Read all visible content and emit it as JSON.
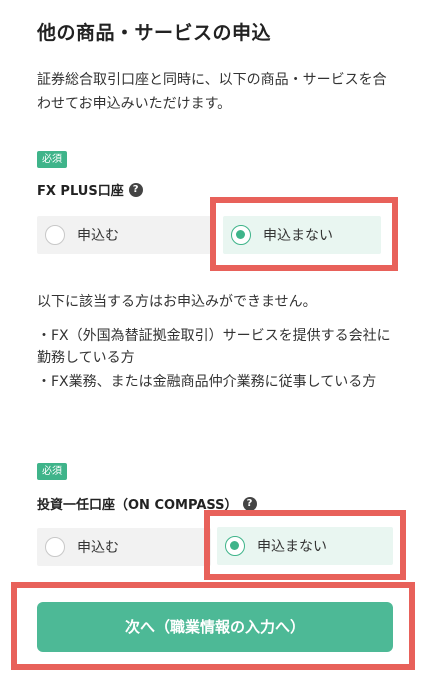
{
  "page": {
    "title": "他の商品・サービスの申込",
    "intro": "証券総合取引口座と同時に、以下の商品・サービスを合わせてお申込みいただけます。"
  },
  "fx_plus": {
    "badge": "必須",
    "label": "FX PLUS口座",
    "help_icon": "question-circle-icon",
    "options": [
      {
        "label": "申込む",
        "selected": false
      },
      {
        "label": "申込まない",
        "selected": true
      }
    ]
  },
  "notice": {
    "heading": "以下に該当する方はお申込みができません。",
    "items": [
      "・FX（外国為替証拠金取引）サービスを提供する会社に勤務している方",
      "・FX業務、または金融商品仲介業務に従事している方"
    ]
  },
  "on_compass": {
    "badge": "必須",
    "label": "投資一任口座（ON COMPASS）",
    "help_icon": "question-circle-icon",
    "options": [
      {
        "label": "申込む",
        "selected": false
      },
      {
        "label": "申込まない",
        "selected": true
      }
    ]
  },
  "next_button": {
    "label": "次へ（職業情報の入力へ）"
  },
  "colors": {
    "accent": "#4db996",
    "highlight": "#e8615a"
  }
}
